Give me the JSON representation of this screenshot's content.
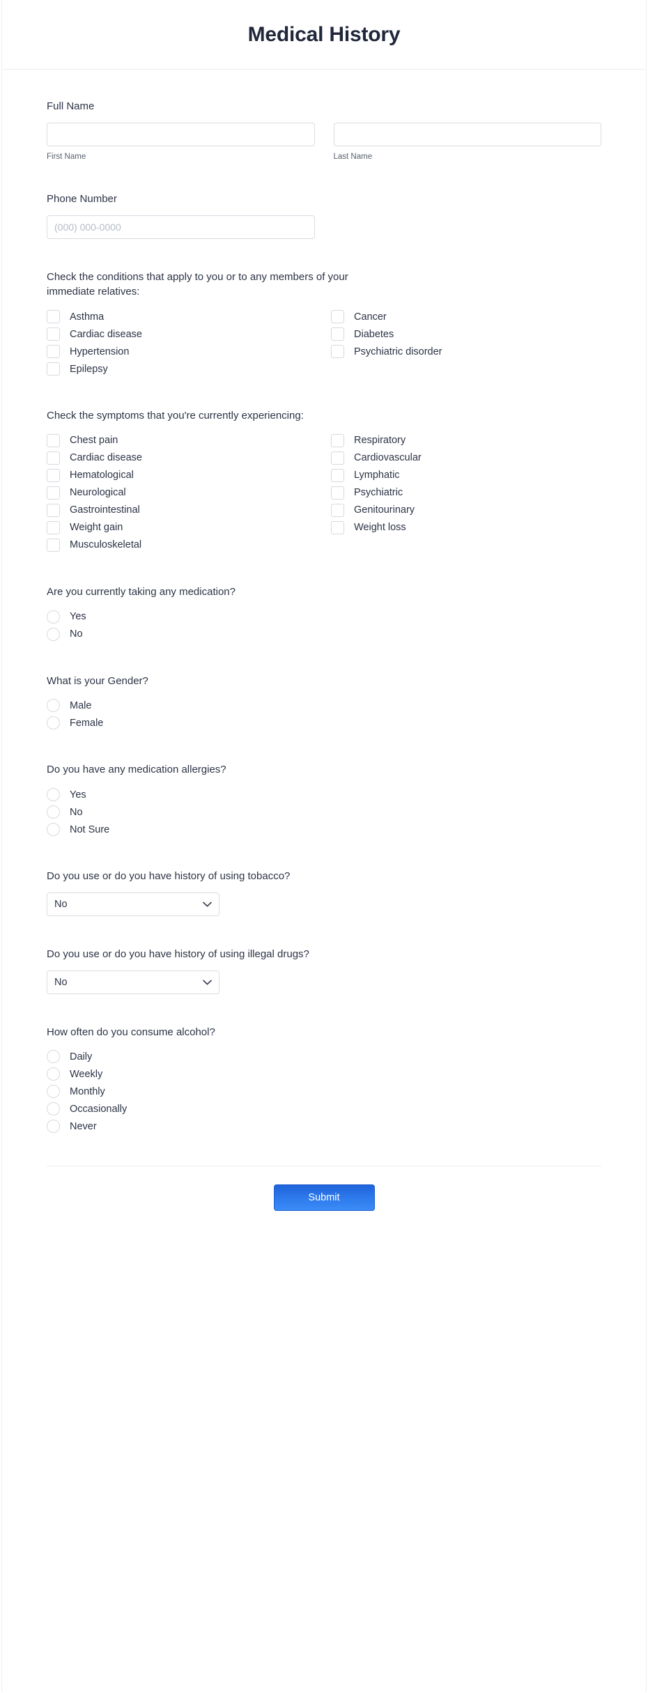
{
  "header": {
    "title": "Medical History"
  },
  "full_name": {
    "label": "Full Name",
    "first": {
      "value": "",
      "placeholder": "",
      "sub_label": "First Name"
    },
    "last": {
      "value": "",
      "placeholder": "",
      "sub_label": "Last Name"
    }
  },
  "phone": {
    "label": "Phone Number",
    "value": "",
    "placeholder": "(000) 000-0000"
  },
  "conditions": {
    "label": "Check the conditions that apply to you or to any members of your immediate relatives:",
    "left": [
      "Asthma",
      "Cardiac disease",
      "Hypertension",
      "Epilepsy"
    ],
    "right": [
      "Cancer",
      "Diabetes",
      "Psychiatric disorder"
    ]
  },
  "symptoms": {
    "label": "Check the symptoms that you're currently experiencing:",
    "left": [
      "Chest pain",
      "Cardiac disease",
      "Hematological",
      "Neurological",
      "Gastrointestinal",
      "Weight gain",
      "Musculoskeletal"
    ],
    "right": [
      "Respiratory",
      "Cardiovascular",
      "Lymphatic",
      "Psychiatric",
      "Genitourinary",
      "Weight loss"
    ]
  },
  "medication": {
    "label": "Are you currently taking any medication?",
    "options": [
      "Yes",
      "No"
    ]
  },
  "gender": {
    "label": "What is your Gender?",
    "options": [
      "Male",
      "Female"
    ]
  },
  "allergies": {
    "label": "Do you have any medication allergies?",
    "options": [
      "Yes",
      "No",
      "Not Sure"
    ]
  },
  "tobacco": {
    "label": "Do you use or do you have history of using tobacco?",
    "selected": "No"
  },
  "drugs": {
    "label": "Do you use or do you have history of using illegal drugs?",
    "selected": "No"
  },
  "alcohol": {
    "label": "How often do you consume alcohol?",
    "options": [
      "Daily",
      "Weekly",
      "Monthly",
      "Occasionally",
      "Never"
    ]
  },
  "footer": {
    "submit_label": "Submit"
  },
  "colors": {
    "accent": "#2f7ced",
    "text": "#2c3345",
    "border": "#d8dce3",
    "divider": "#eceef2"
  }
}
